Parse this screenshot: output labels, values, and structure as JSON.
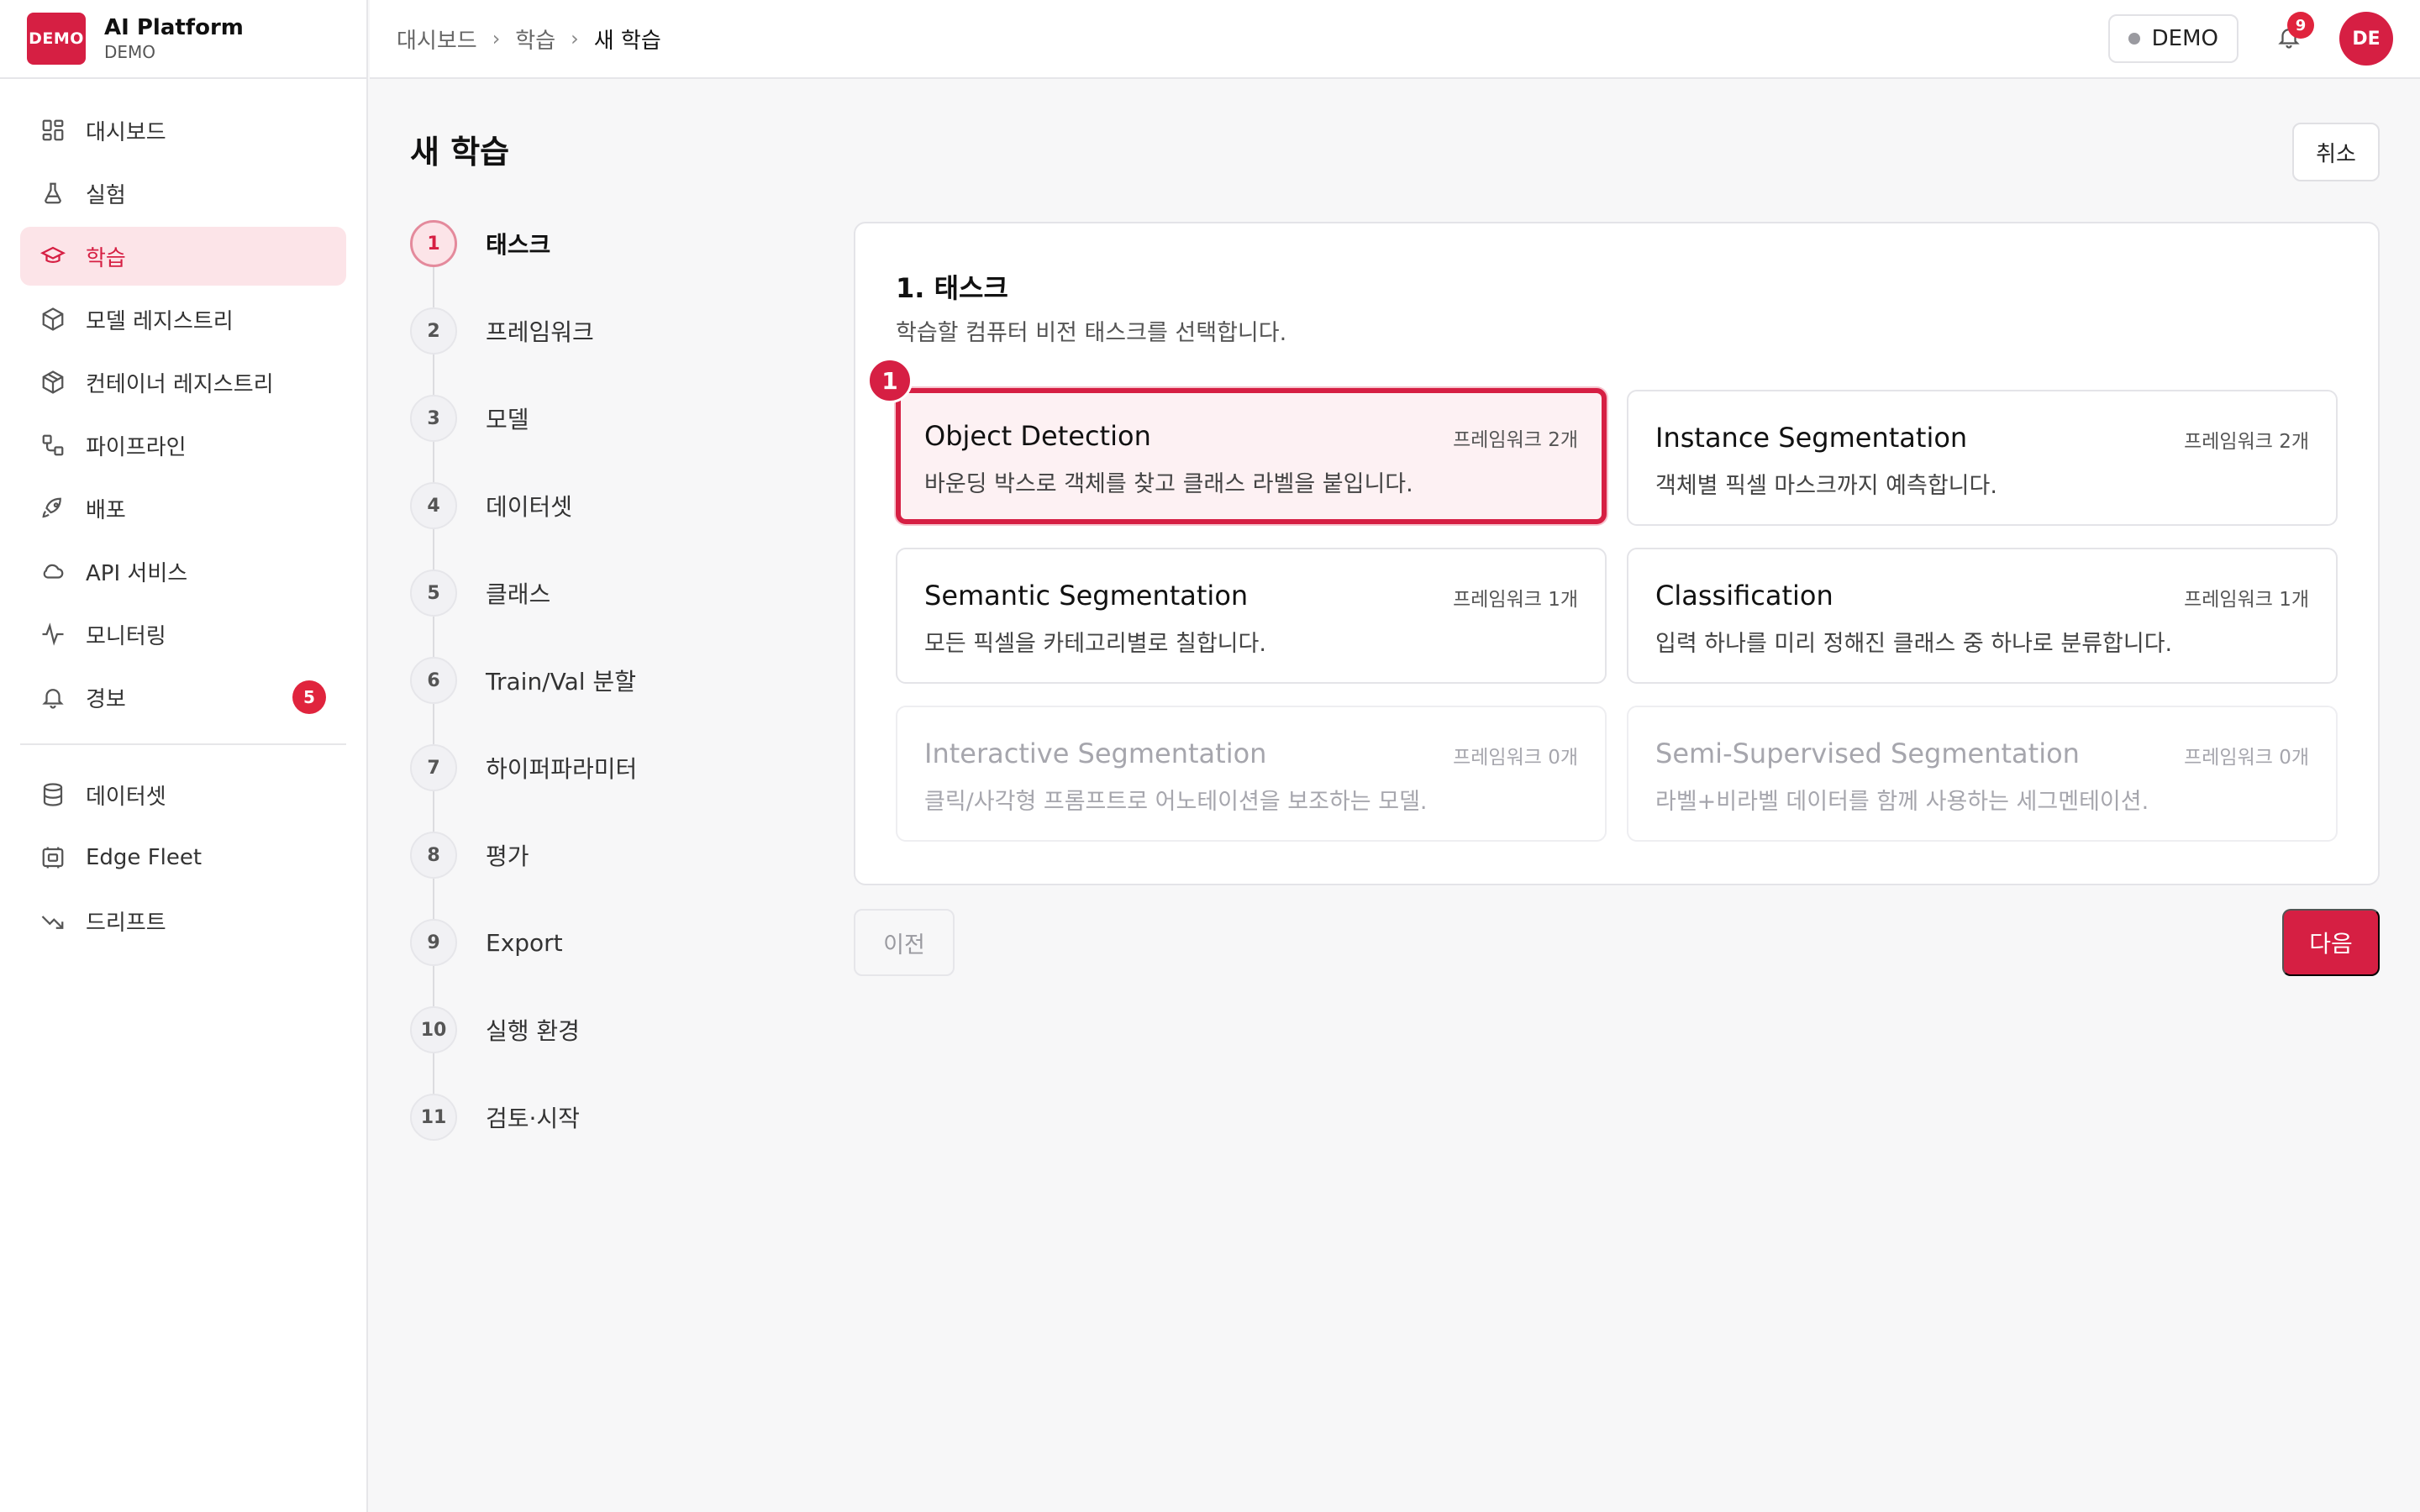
{
  "brand": {
    "logo_text": "DEMO",
    "name": "AI Platform",
    "sub": "DEMO"
  },
  "sidebar": {
    "items": [
      {
        "label": "대시보드",
        "icon": "dashboard-icon"
      },
      {
        "label": "실험",
        "icon": "flask-icon"
      },
      {
        "label": "학습",
        "icon": "graduation-cap-icon",
        "active": true
      },
      {
        "label": "모델 레지스트리",
        "icon": "cube-icon"
      },
      {
        "label": "컨테이너 레지스트리",
        "icon": "package-icon"
      },
      {
        "label": "파이프라인",
        "icon": "workflow-icon"
      },
      {
        "label": "배포",
        "icon": "rocket-icon"
      },
      {
        "label": "API 서비스",
        "icon": "cloud-icon"
      },
      {
        "label": "모니터링",
        "icon": "activity-icon"
      },
      {
        "label": "경보",
        "icon": "bell-icon",
        "badge": "5"
      }
    ],
    "items2": [
      {
        "label": "데이터셋",
        "icon": "database-icon"
      },
      {
        "label": "Edge Fleet",
        "icon": "chip-icon"
      },
      {
        "label": "드리프트",
        "icon": "trend-down-icon"
      }
    ]
  },
  "breadcrumb": {
    "items": [
      "대시보드",
      "학습",
      "새 학습"
    ]
  },
  "topbar": {
    "env_label": "DEMO",
    "notification_count": "9",
    "avatar_initials": "DE"
  },
  "page": {
    "title": "새 학습",
    "cancel_label": "취소"
  },
  "steps": [
    {
      "num": "1",
      "label": "태스크"
    },
    {
      "num": "2",
      "label": "프레임워크"
    },
    {
      "num": "3",
      "label": "모델"
    },
    {
      "num": "4",
      "label": "데이터셋"
    },
    {
      "num": "5",
      "label": "클래스"
    },
    {
      "num": "6",
      "label": "Train/Val 분할"
    },
    {
      "num": "7",
      "label": "하이퍼파라미터"
    },
    {
      "num": "8",
      "label": "평가"
    },
    {
      "num": "9",
      "label": "Export"
    },
    {
      "num": "10",
      "label": "실행 환경"
    },
    {
      "num": "11",
      "label": "검토·시작"
    }
  ],
  "card": {
    "title": "1. 태스크",
    "subtitle": "학습할 컴퓨터 비전 태스크를 선택합니다.",
    "marker": "1",
    "tasks": [
      {
        "title": "Object Detection",
        "count": "프레임워크 2개",
        "desc": "바운딩 박스로 객체를 찾고 클래스 라벨을 붙입니다."
      },
      {
        "title": "Instance Segmentation",
        "count": "프레임워크 2개",
        "desc": "객체별 픽셀 마스크까지 예측합니다."
      },
      {
        "title": "Semantic Segmentation",
        "count": "프레임워크 1개",
        "desc": "모든 픽셀을 카테고리별로 칠합니다."
      },
      {
        "title": "Classification",
        "count": "프레임워크 1개",
        "desc": "입력 하나를 미리 정해진 클래스 중 하나로 분류합니다."
      },
      {
        "title": "Interactive Segmentation",
        "count": "프레임워크 0개",
        "desc": "클릭/사각형 프롬프트로 어노테이션을 보조하는 모델."
      },
      {
        "title": "Semi-Supervised Segmentation",
        "count": "프레임워크 0개",
        "desc": "라벨+비라벨 데이터를 함께 사용하는 세그멘테이션."
      }
    ]
  },
  "footer": {
    "prev_label": "이전",
    "next_label": "다음"
  },
  "colors": {
    "accent": "#d61f43",
    "accent_light": "#fce4e8"
  }
}
